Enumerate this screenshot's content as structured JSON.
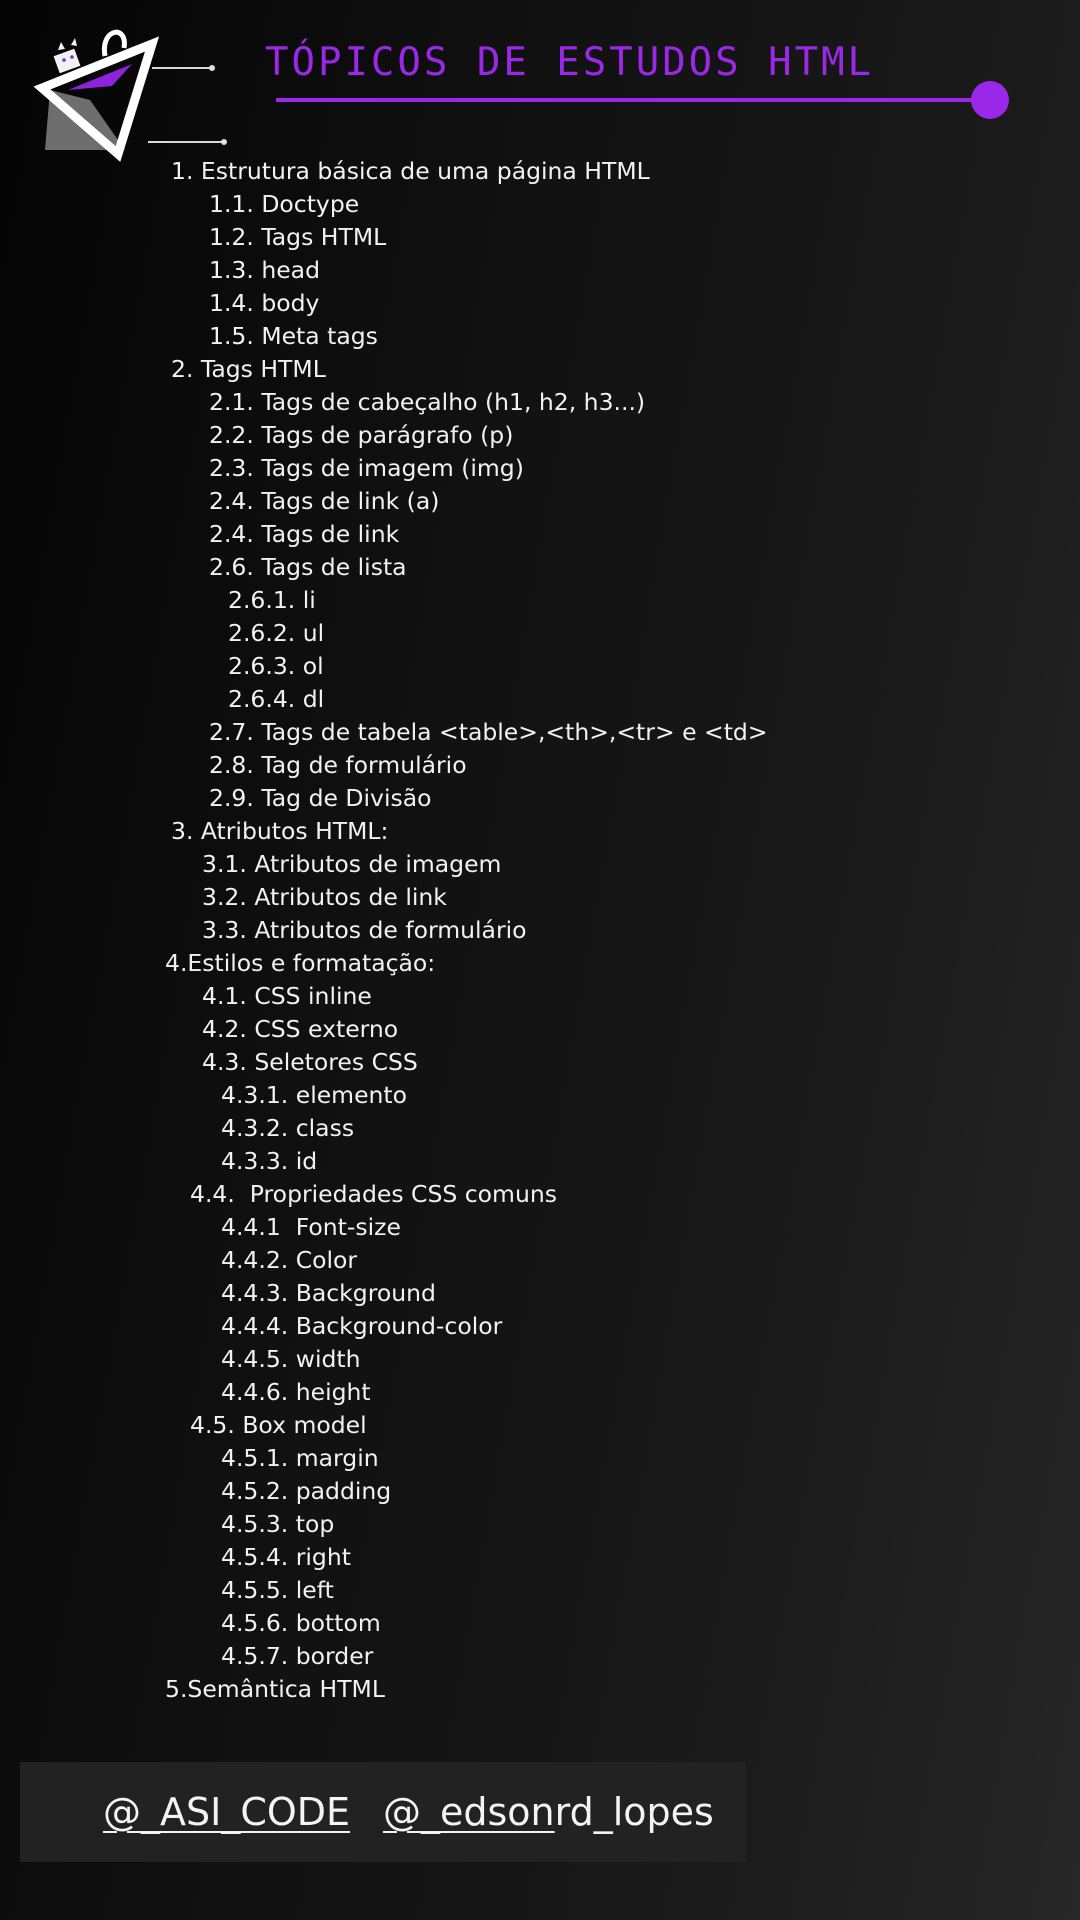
{
  "header": {
    "title": "Tópicos de estudos HTML",
    "accent_color": "#9b27e8",
    "logo_icon": "shopping-bag-triangle-logo-icon"
  },
  "topics": [
    {
      "text": "1. Estrutura básica de uma página HTML",
      "level": 0
    },
    {
      "text": "1.1. Doctype",
      "level": 1
    },
    {
      "text": "1.2. Tags HTML",
      "level": 1
    },
    {
      "text": "1.3. head",
      "level": 1
    },
    {
      "text": "1.4. body",
      "level": 1
    },
    {
      "text": "1.5. Meta tags",
      "level": 1
    },
    {
      "text": "2. Tags HTML",
      "level": 0
    },
    {
      "text": "2.1. Tags de cabeçalho (h1, h2, h3...)",
      "level": 1
    },
    {
      "text": "2.2. Tags de parágrafo (p)",
      "level": 1
    },
    {
      "text": "2.3. Tags de imagem (img)",
      "level": 1
    },
    {
      "text": "2.4. Tags de link (a)",
      "level": 1
    },
    {
      "text": "2.4. Tags de link",
      "level": 1
    },
    {
      "text": "2.6. Tags de lista",
      "level": 1
    },
    {
      "text": "2.6.1. li",
      "level": 2
    },
    {
      "text": "2.6.2. ul",
      "level": 2
    },
    {
      "text": "2.6.3. ol",
      "level": 2
    },
    {
      "text": "2.6.4. dl",
      "level": 2
    },
    {
      "text": "2.7. Tags de tabela <table>,<th>,<tr> e <td>",
      "level": 1
    },
    {
      "text": "2.8. Tag de formulário",
      "level": 1
    },
    {
      "text": "2.9. Tag de Divisão",
      "level": 1
    },
    {
      "text": "3. Atributos HTML:",
      "level": 0
    },
    {
      "text": "3.1. Atributos de imagem",
      "level": 3
    },
    {
      "text": "3.2. Atributos de link",
      "level": 3
    },
    {
      "text": "3.3. Atributos de formulário",
      "level": 3
    },
    {
      "text": "4.Estilos e formatação:",
      "level": 4
    },
    {
      "text": "4.1. CSS inline",
      "level": 3
    },
    {
      "text": "4.2. CSS externo",
      "level": 3
    },
    {
      "text": "4.3. Seletores CSS",
      "level": 3
    },
    {
      "text": "4.3.1. elemento",
      "level": 5
    },
    {
      "text": "4.3.2. class",
      "level": 5
    },
    {
      "text": "4.3.3. id",
      "level": 5
    },
    {
      "text": "4.4.  Propriedades CSS comuns",
      "level": 6
    },
    {
      "text": "4.4.1  Font-size",
      "level": 5
    },
    {
      "text": "4.4.2. Color",
      "level": 5
    },
    {
      "text": "4.4.3. Background",
      "level": 5
    },
    {
      "text": "4.4.4. Background-color",
      "level": 5
    },
    {
      "text": "4.4.5. width",
      "level": 5
    },
    {
      "text": "4.4.6. height",
      "level": 5
    },
    {
      "text": "4.5. Box model",
      "level": 6
    },
    {
      "text": "4.5.1. margin",
      "level": 5
    },
    {
      "text": "4.5.2. padding",
      "level": 5
    },
    {
      "text": "4.5.3. top",
      "level": 5
    },
    {
      "text": "4.5.4. right",
      "level": 5
    },
    {
      "text": "4.5.5. left",
      "level": 5
    },
    {
      "text": "4.5.6. bottom",
      "level": 5
    },
    {
      "text": "4.5.7. border",
      "level": 5
    },
    {
      "text": "5.Semântica HTML",
      "level": 4
    }
  ],
  "footer": {
    "handle_1": "@_ASI_CODE",
    "handle_2_underlined": "@_edson",
    "handle_2_rest": "rd_lopes"
  }
}
